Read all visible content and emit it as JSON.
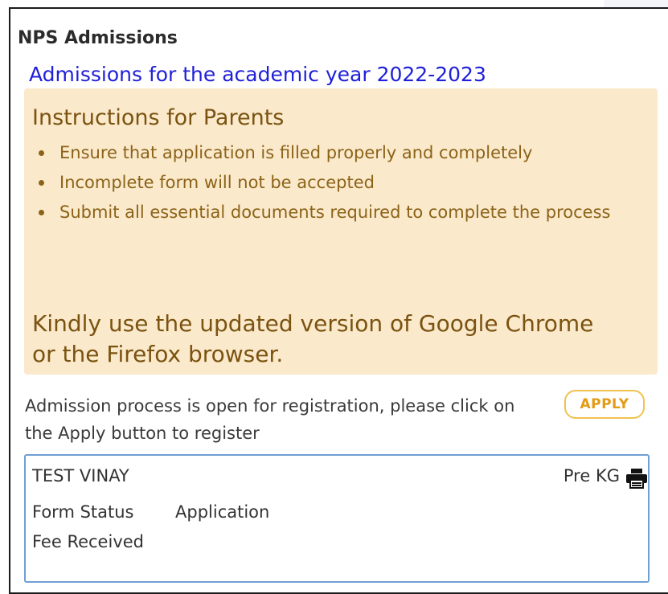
{
  "header": {
    "title": "NPS Admissions"
  },
  "subtitle": "Admissions for the academic year 2022-2023",
  "instructions": {
    "title": "Instructions for Parents",
    "items": [
      "Ensure that application is filled properly and completely",
      "Incomplete form will not be accepted",
      "Submit all essential documents required to complete the process"
    ],
    "footer": "Kindly use the updated version of Google Chrome or the Firefox browser."
  },
  "registration": {
    "message": "Admission process is open for registration, please click on the Apply button to register",
    "apply_label": "APPLY"
  },
  "application": {
    "student_name": "TEST VINAY",
    "class": "Pre KG",
    "form_status_label": "Form Status",
    "form_status_value": "Application",
    "fee_label": "Fee Received",
    "print_icon": "print-icon"
  },
  "colors": {
    "subtitle": "#2020d8",
    "notice_bg": "#fbe9cc",
    "notice_text": "#7a5310",
    "apply_border": "#f0c24f",
    "apply_text": "#e39a15",
    "card_border": "#6f9fd3"
  }
}
